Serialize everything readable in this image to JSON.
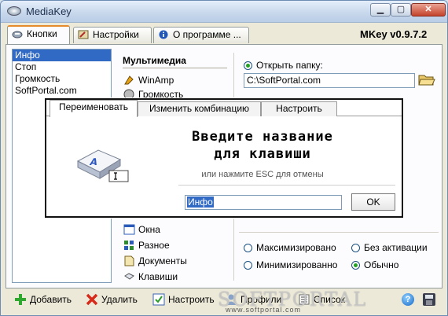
{
  "window": {
    "title": "MediaKey",
    "version": "MKey v0.9.7.2"
  },
  "tabs": [
    {
      "label": "Кнопки",
      "icon": "keyboard-icon"
    },
    {
      "label": "Настройки",
      "icon": "settings-icon"
    },
    {
      "label": "О программе ...",
      "icon": "info-icon"
    }
  ],
  "key_list": [
    "Инфо",
    "Стоп",
    "Громкость",
    "SoftPortal.com"
  ],
  "commands": {
    "header": "Мультимедиа",
    "items_top": [
      {
        "label": "WinAmp",
        "icon": "winamp-icon"
      },
      {
        "label": "Громкость",
        "icon": "volume-icon"
      }
    ],
    "items_bottom": [
      {
        "label": "Окна",
        "icon": "windows-icon"
      },
      {
        "label": "Разное",
        "icon": "misc-icon"
      },
      {
        "label": "Документы",
        "icon": "documents-icon"
      },
      {
        "label": "Клавиши",
        "icon": "keys-icon"
      }
    ]
  },
  "open_folder": {
    "label": "Открыть папку:",
    "path": "C:\\SoftPortal.com"
  },
  "window_mode": {
    "maximized": "Максимизировано",
    "minimized": "Минимизированно",
    "no_activate": "Без активации",
    "normal": "Обычно",
    "selected": "normal"
  },
  "toolbar": {
    "add": "Добавить",
    "delete": "Удалить",
    "configure": "Настроить",
    "profiles": "Профили",
    "list": "Список"
  },
  "watermark": {
    "text": "SOFTPORTAL",
    "url": "www.softportal.com"
  },
  "dialog": {
    "tabs": [
      "Переименовать",
      "Изменить комбинацию",
      "Настроить"
    ],
    "title_line1": "Введите название",
    "title_line2": "для клавиши",
    "hint": "или нажмите ESC для отмены",
    "input_value": "Инфо",
    "ok_label": "OK"
  },
  "colors": {
    "selection": "#316ac5",
    "tab_highlight": "#e68b2c",
    "radio_dot": "#21a121"
  }
}
